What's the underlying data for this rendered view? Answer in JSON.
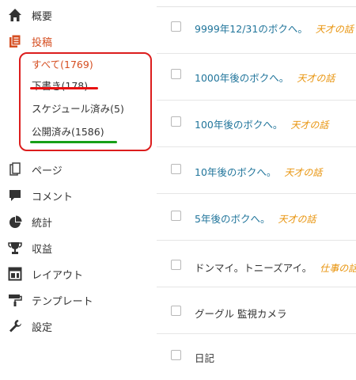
{
  "sidebar": {
    "items": [
      {
        "label": "概要",
        "icon": "home-icon"
      },
      {
        "label": "投稿",
        "icon": "posts-icon",
        "active": true
      },
      {
        "label": "ページ",
        "icon": "pages-icon"
      },
      {
        "label": "コメント",
        "icon": "comment-icon"
      },
      {
        "label": "統計",
        "icon": "pie-chart-icon"
      },
      {
        "label": "収益",
        "icon": "trophy-icon"
      },
      {
        "label": "レイアウト",
        "icon": "layout-icon"
      },
      {
        "label": "テンプレート",
        "icon": "paint-roller-icon"
      },
      {
        "label": "設定",
        "icon": "wrench-icon"
      }
    ],
    "submenu": [
      {
        "label": "すべて(1769)"
      },
      {
        "label": "下書き(178)"
      },
      {
        "label": "スケジュール済み(5)"
      },
      {
        "label": "公開済み(1586)"
      }
    ]
  },
  "colors": {
    "accent_orange": "#d54e21",
    "link_blue": "#21759b",
    "category_orange": "#e8930b",
    "highlight_red": "#dc1d1d",
    "highlight_green": "#18a018"
  },
  "posts": [
    {
      "title": "9999年12/31のボクへ。",
      "category": "天才の話"
    },
    {
      "title": "1000年後のボクへ。",
      "category": "天才の話"
    },
    {
      "title": "100年後のボクへ。",
      "category": "天才の話"
    },
    {
      "title": "10年後のボクへ。",
      "category": "天才の話"
    },
    {
      "title": "5年後のボクへ。",
      "category": "天才の話"
    },
    {
      "title": "ドンマイ。トニーズアイ。",
      "category": "仕事の話"
    },
    {
      "title": "グーグル 監視カメラ",
      "category": ""
    },
    {
      "title": "日記",
      "category": ""
    }
  ]
}
